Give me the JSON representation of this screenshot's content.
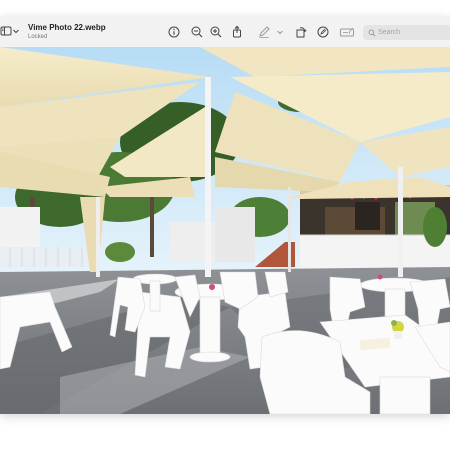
{
  "window": {
    "title": "Vime Photo 22.webp",
    "subtitle": "Locked"
  },
  "toolbar": {
    "icons": [
      "sidebar-icon",
      "chevron-down-icon",
      "info-icon",
      "zoom-out-icon",
      "zoom-in-icon",
      "share-icon",
      "markup-pen-icon",
      "chevron-down-icon",
      "rotate-icon",
      "annotate-icon",
      "form-fill-icon"
    ],
    "search_placeholder": "Search"
  },
  "photo": {
    "description_alt": "Vime Photo 22.webp",
    "colors": {
      "sky": "#bfe3f8",
      "sail": "#f2e7c3",
      "floor": "#7b7e82",
      "furniture": "#fafafa"
    }
  }
}
